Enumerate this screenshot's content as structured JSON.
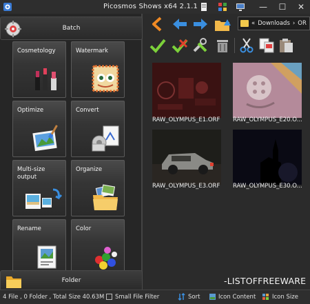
{
  "window": {
    "title": "Picosmos Shows x64 2.1.1"
  },
  "left_panel": {
    "batch_label": "Batch",
    "folder_label": "Folder",
    "tiles": [
      {
        "label": "Cosmetology"
      },
      {
        "label": "Watermark"
      },
      {
        "label": "Optimize"
      },
      {
        "label": "Convert"
      },
      {
        "label": "Multi-size output"
      },
      {
        "label": "Organize"
      },
      {
        "label": "Rename"
      },
      {
        "label": "Color"
      }
    ]
  },
  "toolbar": {
    "path": {
      "prefix": "«",
      "segment": "Downloads",
      "separator": "›",
      "trailing": "OR"
    }
  },
  "thumbnails": [
    {
      "name": "RAW_OLYMPUS_E1.ORF"
    },
    {
      "name": "RAW_OLYMPUS_E20.O..."
    },
    {
      "name": "RAW_OLYMPUS_E3.ORF"
    },
    {
      "name": "RAW_OLYMPUS_E30.O..."
    }
  ],
  "watermark_text": "-LISTOFFREEWARE",
  "status": {
    "summary": "4 File , 0 Folder , Total Size 40.63M",
    "small_file_filter": "Small File Filter",
    "sort": "Sort",
    "icon_content": "Icon Content",
    "icon_size": "Icon Size"
  },
  "colors": {
    "accent_green": "#7cd13a",
    "accent_red": "#e0402a",
    "accent_blue": "#3a8fe0",
    "accent_orange": "#f08a24"
  }
}
